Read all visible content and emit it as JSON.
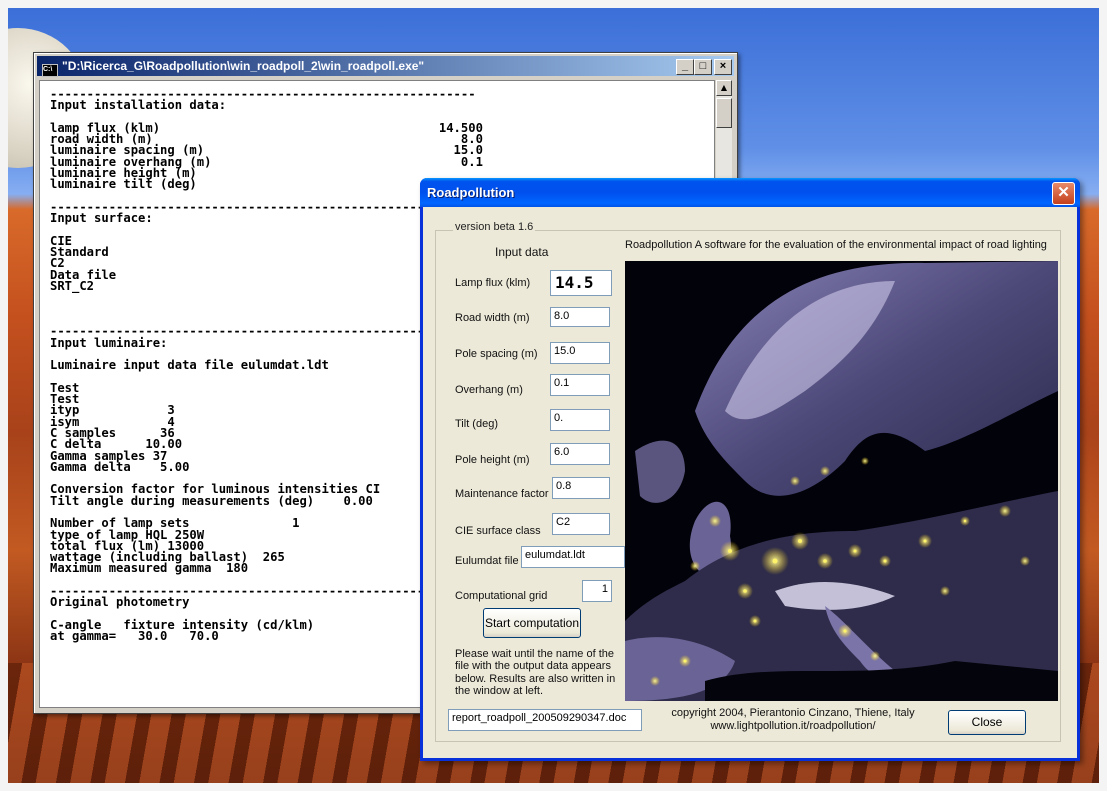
{
  "console": {
    "title": "\"D:\\Ricerca_G\\Roadpollution\\win_roadpoll_2\\win_roadpoll.exe\"",
    "window_buttons": {
      "minimize": "_",
      "maximize": "□",
      "close": "×"
    },
    "output": [
      "----------------------------------------------------------",
      "Input installation data:",
      "",
      "lamp flux (klm)                                      14.500",
      "road width (m)                                          8.0",
      "luminaire spacing (m)                                  15.0",
      "luminaire overhang (m)                                  0.1",
      "luminaire height (m)",
      "luminaire tilt (deg)",
      "",
      "----------------------------------------------------------",
      "Input surface:",
      "",
      "CIE",
      "Standard",
      "C2",
      "Data file",
      "SRT_C2",
      "",
      "",
      "",
      "----------------------------------------------------------",
      "Input luminaire:",
      "",
      "Luminaire input data file eulumdat.ldt",
      "",
      "Test",
      "Test",
      "ityp            3",
      "isym            4",
      "C samples      36",
      "C delta      10.00",
      "Gamma samples 37",
      "Gamma delta    5.00",
      "",
      "Conversion factor for luminous intensities CI",
      "Tilt angle during measurements (deg)    0.00",
      "",
      "Number of lamp sets              1",
      "type of lamp HQL 250W",
      "total flux (lm) 13000",
      "wattage (including ballast)  265",
      "Maximum measured gamma  180",
      "",
      "----------------------------------------------------------",
      "Original photometry",
      "",
      "C-angle   fixture intensity (cd/klm)",
      "at gamma=   30.0   70.0"
    ]
  },
  "dialog": {
    "title": "Roadpollution",
    "close_glyph": "✕",
    "group_label": "version beta 1.6",
    "input_heading": "Input data",
    "header_text": "Roadpollution  A software for the evaluation of the environmental impact of road lighting",
    "fields": [
      {
        "label": "Lamp flux (klm)",
        "value": "14.5"
      },
      {
        "label": "Road width (m)",
        "value": "8.0"
      },
      {
        "label": "Pole spacing (m)",
        "value": "15.0"
      },
      {
        "label": "Overhang (m)",
        "value": "0.1"
      },
      {
        "label": "Tilt (deg)",
        "value": "0."
      },
      {
        "label": "Pole height (m)",
        "value": "6.0"
      },
      {
        "label": "Maintenance factor",
        "value": "0.8"
      },
      {
        "label": "CIE surface class",
        "value": "C2"
      },
      {
        "label": "Eulumdat file",
        "value": "eulumdat.ldt"
      },
      {
        "label": "Computational grid",
        "value": "1"
      }
    ],
    "start_button": "Start computation",
    "info_text": "Please wait until the name of the file with the output data appears below. Results are also written in the window at left.",
    "output_file": "report_roadpoll_200509290347.doc",
    "copyright": "copyright 2004, Pierantonio Cinzano, Thiene, Italy",
    "website": "www.lightpollution.it/roadpollution/",
    "close_button": "Close"
  }
}
